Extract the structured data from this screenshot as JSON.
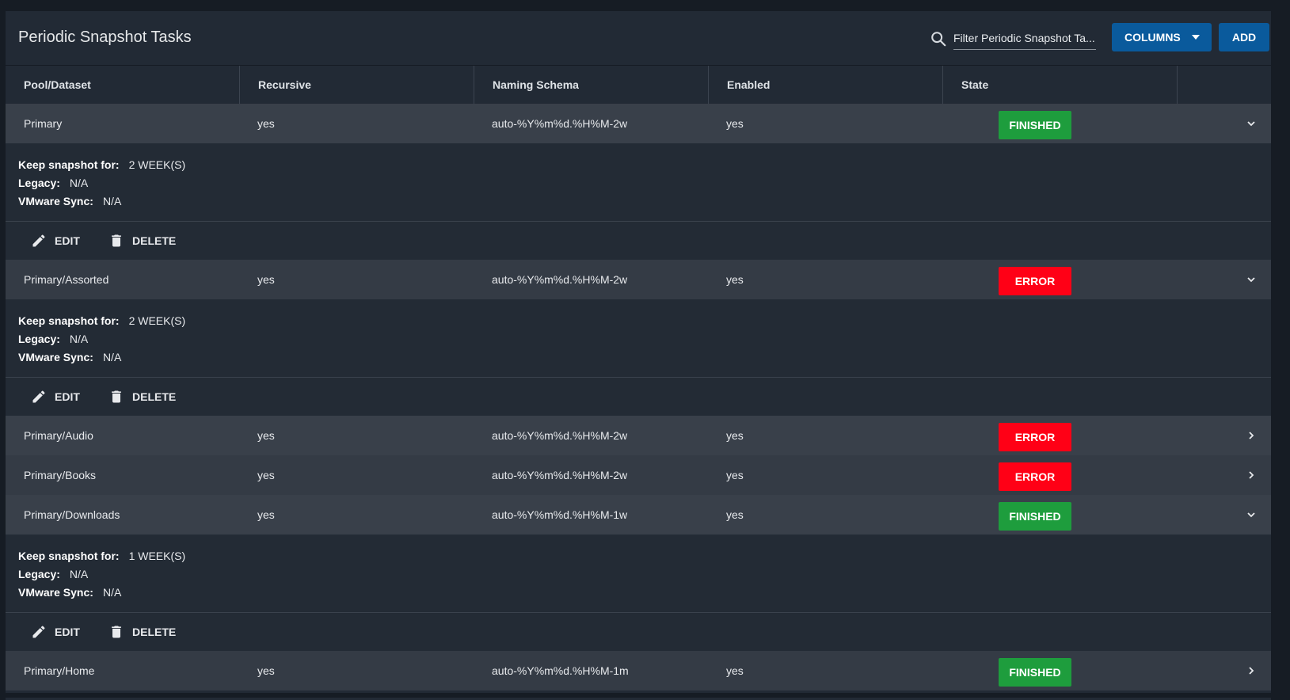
{
  "page": {
    "title": "Periodic Snapshot Tasks",
    "filter_placeholder": "Filter Periodic Snapshot Ta...",
    "columns_label": "COLUMNS",
    "add_label": "ADD"
  },
  "headers": [
    "Pool/Dataset",
    "Recursive",
    "Naming Schema",
    "Enabled",
    "State"
  ],
  "labels": {
    "keep": "Keep snapshot for:",
    "legacy": "Legacy:",
    "vmware": "VMware Sync:",
    "edit": "EDIT",
    "delete": "DELETE"
  },
  "rows": [
    {
      "dataset": "Primary",
      "recursive": "yes",
      "schema": "auto-%Y%m%d.%H%M-2w",
      "enabled": "yes",
      "state": "FINISHED",
      "state_color": "#1e9d3d",
      "expanded": true,
      "keep": "2 WEEK(S)",
      "legacy": "N/A",
      "vmware": "N/A"
    },
    {
      "dataset": "Primary/Assorted",
      "recursive": "yes",
      "schema": "auto-%Y%m%d.%H%M-2w",
      "enabled": "yes",
      "state": "ERROR",
      "state_color": "#ff0016",
      "expanded": true,
      "keep": "2 WEEK(S)",
      "legacy": "N/A",
      "vmware": "N/A"
    },
    {
      "dataset": "Primary/Audio",
      "recursive": "yes",
      "schema": "auto-%Y%m%d.%H%M-2w",
      "enabled": "yes",
      "state": "ERROR",
      "state_color": "#ff0016",
      "expanded": false
    },
    {
      "dataset": "Primary/Books",
      "recursive": "yes",
      "schema": "auto-%Y%m%d.%H%M-2w",
      "enabled": "yes",
      "state": "ERROR",
      "state_color": "#ff0016",
      "expanded": false
    },
    {
      "dataset": "Primary/Downloads",
      "recursive": "yes",
      "schema": "auto-%Y%m%d.%H%M-1w",
      "enabled": "yes",
      "state": "FINISHED",
      "state_color": "#1e9d3d",
      "expanded": true,
      "keep": "1 WEEK(S)",
      "legacy": "N/A",
      "vmware": "N/A"
    },
    {
      "dataset": "Primary/Home",
      "recursive": "yes",
      "schema": "auto-%Y%m%d.%H%M-1m",
      "enabled": "yes",
      "state": "FINISHED",
      "state_color": "#1e9d3d",
      "expanded": false
    }
  ],
  "icons": {
    "search": "search-icon",
    "caret": "caret-down-icon",
    "edit": "pencil-icon",
    "delete": "trash-icon",
    "expanded": "chevron-down-icon",
    "collapsed": "chevron-right-icon"
  }
}
